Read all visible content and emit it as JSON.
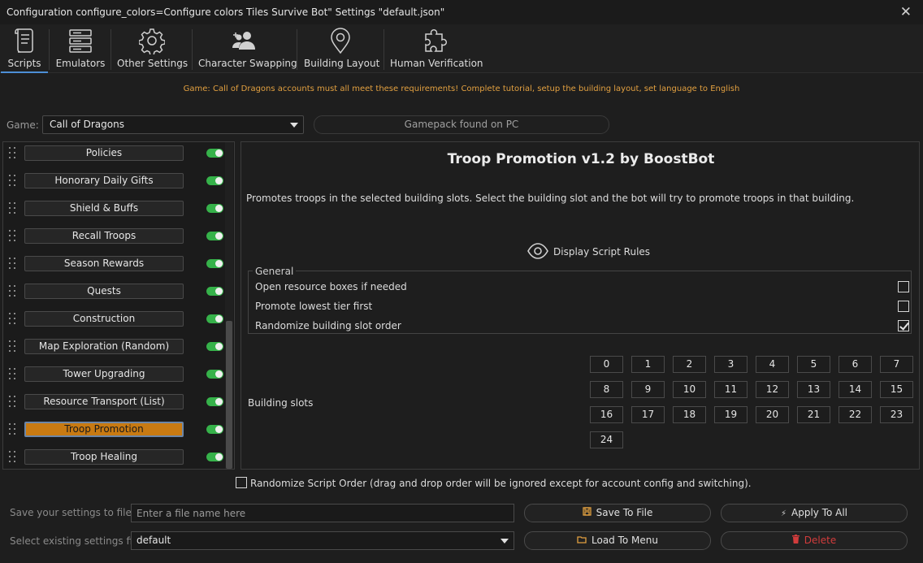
{
  "window": {
    "title": "Configuration configure_colors=Configure colors Tiles Survive Bot\" Settings \"default.json\"",
    "close_glyph": "✕"
  },
  "toolbar": {
    "tabs": [
      {
        "label": "Scripts",
        "icon": "scroll-icon",
        "active": true
      },
      {
        "label": "Emulators",
        "icon": "server-icon"
      },
      {
        "label": "Other Settings",
        "icon": "gear-icon"
      },
      {
        "label": "Character Swapping",
        "icon": "users-icon"
      },
      {
        "label": "Building Layout",
        "icon": "map-pin-icon"
      },
      {
        "label": "Human Verification",
        "icon": "puzzle-icon"
      }
    ]
  },
  "notice": "Game: Call of Dragons accounts must all meet these requirements! Complete tutorial, setup the building layout, set language to English",
  "game": {
    "label": "Game:",
    "selected": "Call of Dragons",
    "gamepack_status": "Gamepack found on PC"
  },
  "scripts": [
    {
      "label": "Policies",
      "enabled": true
    },
    {
      "label": "Honorary Daily Gifts",
      "enabled": true
    },
    {
      "label": "Shield & Buffs",
      "enabled": true
    },
    {
      "label": "Recall Troops",
      "enabled": true
    },
    {
      "label": "Season Rewards",
      "enabled": true
    },
    {
      "label": "Quests",
      "enabled": true
    },
    {
      "label": "Construction",
      "enabled": true
    },
    {
      "label": "Map Exploration (Random)",
      "enabled": true
    },
    {
      "label": "Tower Upgrading",
      "enabled": true
    },
    {
      "label": "Resource Transport (List)",
      "enabled": true
    },
    {
      "label": "Troop Promotion",
      "enabled": true,
      "selected": true
    },
    {
      "label": "Troop Healing",
      "enabled": true
    }
  ],
  "detail": {
    "title": "Troop Promotion v1.2 by BoostBot",
    "description": "Promotes troops in the selected building slots. Select the building slot and the bot will try to promote troops in that building.",
    "rules_link": "Display Script Rules",
    "general": {
      "legend": "General",
      "options": [
        {
          "label": "Open resource boxes if needed",
          "checked": false
        },
        {
          "label": "Promote lowest tier first",
          "checked": false
        },
        {
          "label": "Randomize building slot order",
          "checked": true
        }
      ]
    },
    "building_slots_label": "Building slots",
    "slots": [
      "0",
      "1",
      "2",
      "3",
      "4",
      "5",
      "6",
      "7",
      "8",
      "9",
      "10",
      "11",
      "12",
      "13",
      "14",
      "15",
      "16",
      "17",
      "18",
      "19",
      "20",
      "21",
      "22",
      "23",
      "24"
    ]
  },
  "randomize_order": {
    "label": "Randomize Script Order (drag and drop order will be ignored except for account config and switching).",
    "checked": false
  },
  "footer": {
    "save_label": "Save your settings to file",
    "file_placeholder": "Enter a file name here",
    "select_label": "Select existing settings file",
    "selected_file": "default",
    "save_button": "Save To File",
    "apply_button": "Apply To All",
    "load_button": "Load To Menu",
    "delete_button": "Delete"
  },
  "colors": {
    "accent": "#4d8fd6",
    "selected_script": "#c87a12",
    "toggle_on": "#36b24a",
    "notice": "#e2a040",
    "delete": "#d23c3c"
  }
}
